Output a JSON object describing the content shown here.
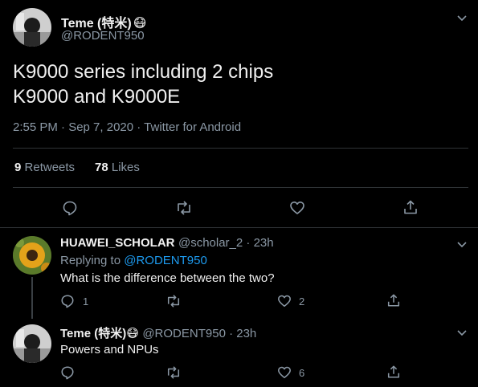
{
  "main_tweet": {
    "author_name": "Teme (特米)",
    "author_emoji": "😷",
    "handle": "@RODENT950",
    "text_line1": "K9000 series including 2 chips",
    "text_line2": "K9000 and K9000E",
    "meta": "2:55 PM · Sep 7, 2020 · Twitter for Android",
    "retweets_count": "9",
    "retweets_label": "Retweets",
    "likes_count": "78",
    "likes_label": "Likes"
  },
  "reply1": {
    "author_name": "HUAWEI_SCHOLAR",
    "handle_time": "@scholar_2 · 23h",
    "replying_prefix": "Replying to",
    "replying_handle": "@RODENT950",
    "text": "What is the difference between the two?",
    "reply_count": "1",
    "like_count": "2"
  },
  "reply2": {
    "author_name": "Teme (特米)",
    "author_emoji": "😷",
    "handle_time": "@RODENT950 · 23h",
    "text": "Powers and NPUs",
    "like_count": "6"
  },
  "colors": {
    "background": "#000000",
    "accent": "#1d9bf0",
    "secondary_text": "#8b98a5"
  }
}
